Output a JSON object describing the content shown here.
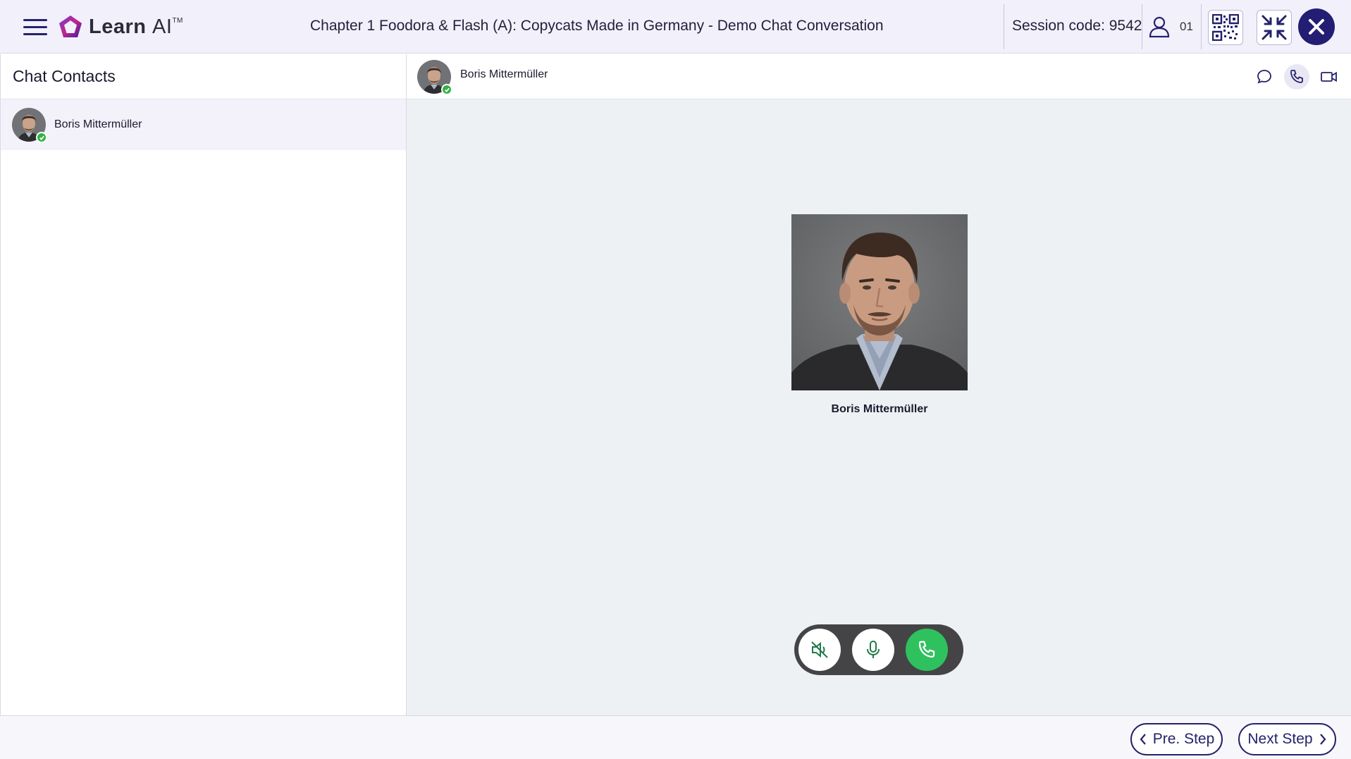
{
  "app": {
    "brand": "Learn AI",
    "brand_prefix": "Learn",
    "brand_suffix": "AI",
    "brand_mark": "TM",
    "title": "Chapter 1 Foodora & Flash (A): Copycats Made in Germany - Demo Chat Conversation",
    "session_label": "Session code: 9542",
    "user_count": "01",
    "accent_color": "#25226b"
  },
  "contacts": {
    "title": "Chat Contacts",
    "items": [
      {
        "name": "Boris Mittermüller",
        "status": "online"
      }
    ]
  },
  "chat": {
    "contact_name": "Boris Mittermüller",
    "caller_name": "Boris Mittermüller",
    "header_icons": [
      "chat-bubble-icon",
      "phone-icon",
      "video-icon"
    ],
    "active_mode": "phone"
  },
  "call_controls": {
    "buttons": [
      "speaker-muted-icon",
      "microphone-icon",
      "phone-call-icon"
    ]
  },
  "footer": {
    "prev_label": "Pre. Step",
    "next_label": "Next Step"
  }
}
